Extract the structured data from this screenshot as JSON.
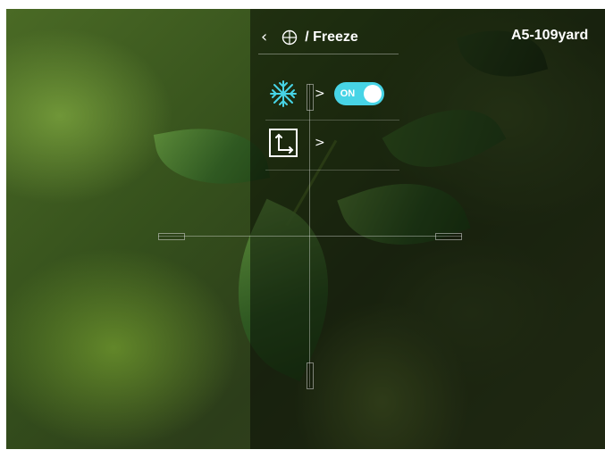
{
  "header": {
    "back_icon": "chevron-left-icon",
    "crosshair_icon": "crosshair-icon",
    "breadcrumb": "/ Freeze"
  },
  "status": {
    "label": "A5-109yard"
  },
  "menu": {
    "items": [
      {
        "icon": "snowflake-freeze-icon",
        "chevron": ">",
        "toggle_label": "ON",
        "toggle_on": true
      },
      {
        "icon": "corner-mode-icon",
        "chevron": ">"
      }
    ]
  },
  "colors": {
    "accent": "#47d4e6",
    "text": "#ffffff"
  }
}
